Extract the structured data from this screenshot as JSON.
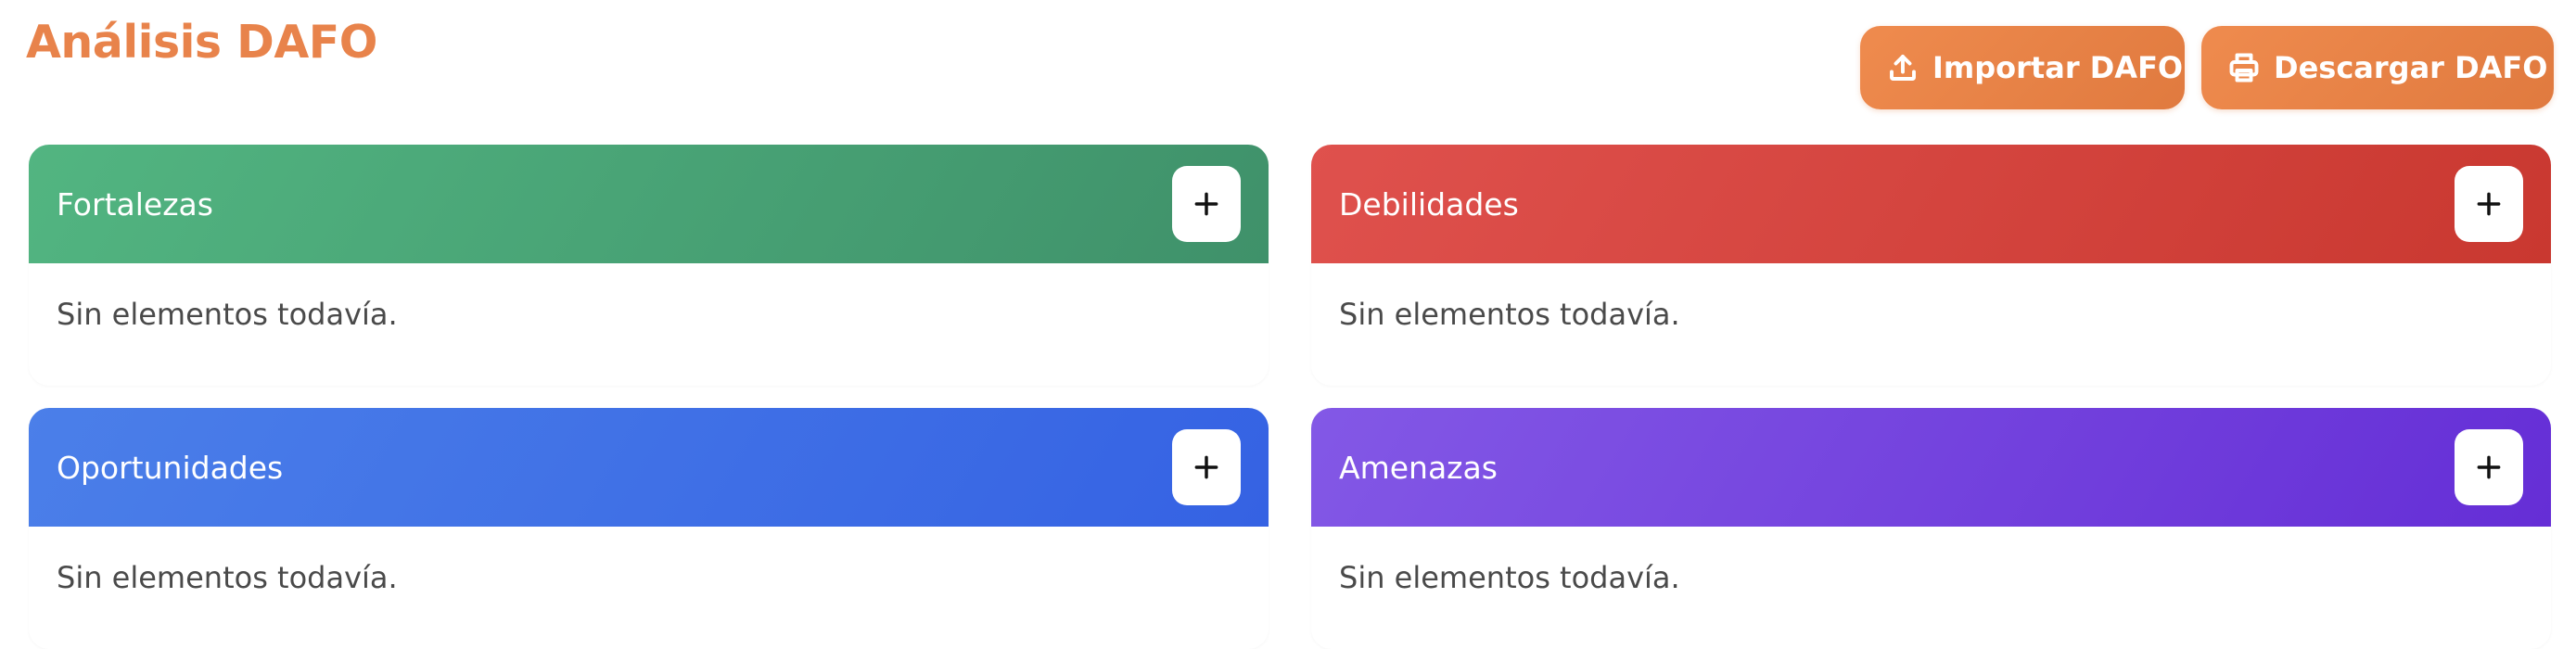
{
  "header": {
    "title": "Análisis DAFO"
  },
  "toolbar": {
    "import_label": "Importar DAFO",
    "import_icon": "upload-icon",
    "download_label": "Descargar DAFO",
    "download_icon": "printer-icon"
  },
  "colors": {
    "accent": "#e8834b",
    "fortalezas": "#4aa575",
    "debilidades": "#d6443f",
    "oportunidades": "#4270e6",
    "amenazas": "#7443de"
  },
  "quadrants": [
    {
      "title": "Fortalezas",
      "empty_text": "Sin elementos todavía.",
      "add_icon": "plus-icon"
    },
    {
      "title": "Debilidades",
      "empty_text": "Sin elementos todavía.",
      "add_icon": "plus-icon"
    },
    {
      "title": "Oportunidades",
      "empty_text": "Sin elementos todavía.",
      "add_icon": "plus-icon"
    },
    {
      "title": "Amenazas",
      "empty_text": "Sin elementos todavía.",
      "add_icon": "plus-icon"
    }
  ]
}
